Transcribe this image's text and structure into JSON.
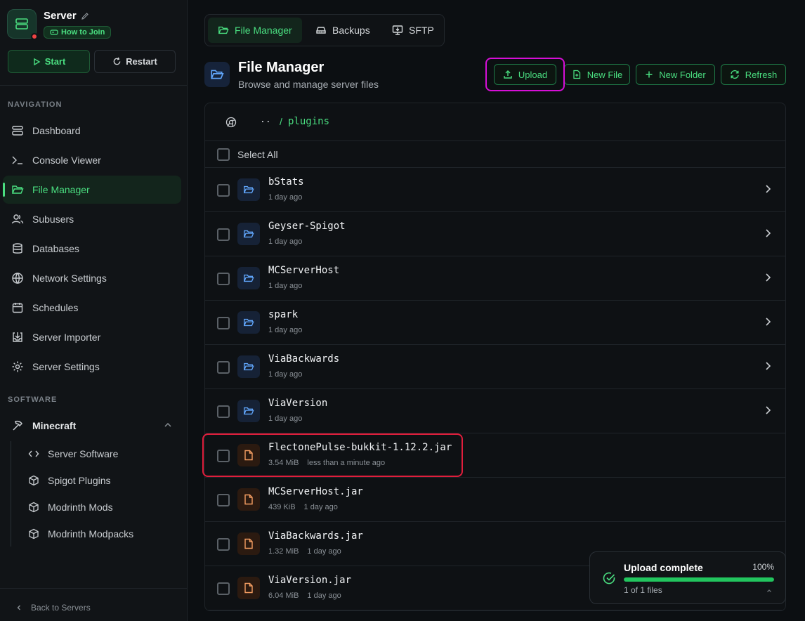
{
  "sidebar": {
    "server_name": "Server",
    "how_to_join": "How to Join",
    "start": "Start",
    "restart": "Restart",
    "nav_heading": "NAVIGATION",
    "nav": [
      {
        "label": "Dashboard",
        "icon": "dashboard-icon"
      },
      {
        "label": "Console Viewer",
        "icon": "terminal-icon"
      },
      {
        "label": "File Manager",
        "icon": "folder-icon",
        "active": true
      },
      {
        "label": "Subusers",
        "icon": "users-icon"
      },
      {
        "label": "Databases",
        "icon": "database-icon"
      },
      {
        "label": "Network Settings",
        "icon": "globe-icon"
      },
      {
        "label": "Schedules",
        "icon": "calendar-icon"
      },
      {
        "label": "Server Importer",
        "icon": "import-icon"
      },
      {
        "label": "Server Settings",
        "icon": "gear-icon"
      }
    ],
    "software_heading": "SOFTWARE",
    "software_group": "Minecraft",
    "software_items": [
      {
        "label": "Server Software",
        "icon": "code-icon"
      },
      {
        "label": "Spigot Plugins",
        "icon": "cube-icon"
      },
      {
        "label": "Modrinth Mods",
        "icon": "cube-icon"
      },
      {
        "label": "Modrinth Modpacks",
        "icon": "cube-icon"
      }
    ],
    "back": "Back to Servers"
  },
  "tabs": [
    {
      "label": "File Manager",
      "active": true
    },
    {
      "label": "Backups"
    },
    {
      "label": "SFTP"
    }
  ],
  "header": {
    "title": "File Manager",
    "subtitle": "Browse and manage server files",
    "actions": {
      "upload": "Upload",
      "new_file": "New File",
      "new_folder": "New Folder",
      "refresh": "Refresh"
    }
  },
  "breadcrumb": {
    "up": "..",
    "slash": "/",
    "path": "plugins"
  },
  "select_all": "Select All",
  "files": [
    {
      "name": "bStats",
      "type": "dir",
      "size": "",
      "modified": "1 day ago"
    },
    {
      "name": "Geyser-Spigot",
      "type": "dir",
      "size": "",
      "modified": "1 day ago"
    },
    {
      "name": "MCServerHost",
      "type": "dir",
      "size": "",
      "modified": "1 day ago"
    },
    {
      "name": "spark",
      "type": "dir",
      "size": "",
      "modified": "1 day ago"
    },
    {
      "name": "ViaBackwards",
      "type": "dir",
      "size": "",
      "modified": "1 day ago"
    },
    {
      "name": "ViaVersion",
      "type": "dir",
      "size": "",
      "modified": "1 day ago"
    },
    {
      "name": "FlectonePulse-bukkit-1.12.2.jar",
      "type": "file",
      "size": "3.54 MiB",
      "modified": "less than a minute ago"
    },
    {
      "name": "MCServerHost.jar",
      "type": "file",
      "size": "439 KiB",
      "modified": "1 day ago"
    },
    {
      "name": "ViaBackwards.jar",
      "type": "file",
      "size": "1.32 MiB",
      "modified": "1 day ago"
    },
    {
      "name": "ViaVersion.jar",
      "type": "file",
      "size": "6.04 MiB",
      "modified": "1 day ago"
    }
  ],
  "toast": {
    "title": "Upload complete",
    "percent_label": "100%",
    "progress": 1.0,
    "subtitle": "1 of 1 files"
  },
  "colors": {
    "accent": "#4ade80",
    "highlight_magenta": "#d60fd6",
    "highlight_red": "#e01e3c"
  }
}
